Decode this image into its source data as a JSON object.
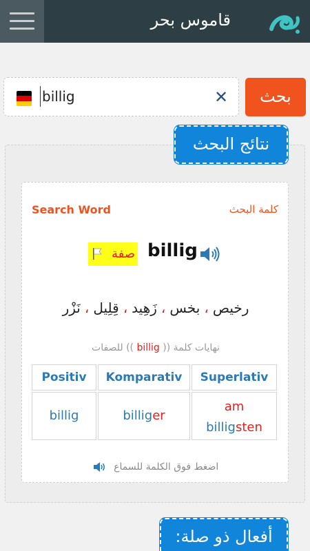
{
  "app": {
    "title": "قاموس بحر"
  },
  "search": {
    "value": "billig",
    "button_label": "بحث",
    "language": "German"
  },
  "results": {
    "header": "نتائج البحث",
    "search_word_label": "Search Word",
    "search_word_label_ar": "كلمة البحث",
    "word": "billig",
    "part_of_speech": "صفة",
    "translations": [
      "رخيص",
      "بخس",
      "زَهِيد",
      "قِلِيل",
      "نَزْر"
    ],
    "endings_title_before": "نهايات كلمة ((",
    "endings_word": "billig",
    "endings_title_after": ")) للصفات",
    "table": {
      "headers": [
        "Positiv",
        "Komparativ",
        "Superlativ"
      ],
      "positiv": "billig",
      "komparativ_stem": "billig",
      "komparativ_ending": "er",
      "superlativ_prefix": "am",
      "superlativ_stem": "billig",
      "superlativ_ending": "sten"
    },
    "hint": "اضغط فوق الكلمة للسماع"
  },
  "related": {
    "header": "أفعال ذو صلة:"
  },
  "colors": {
    "accent": "#f0531e",
    "primary": "#1185d9",
    "topbar": "#2d3e45"
  }
}
